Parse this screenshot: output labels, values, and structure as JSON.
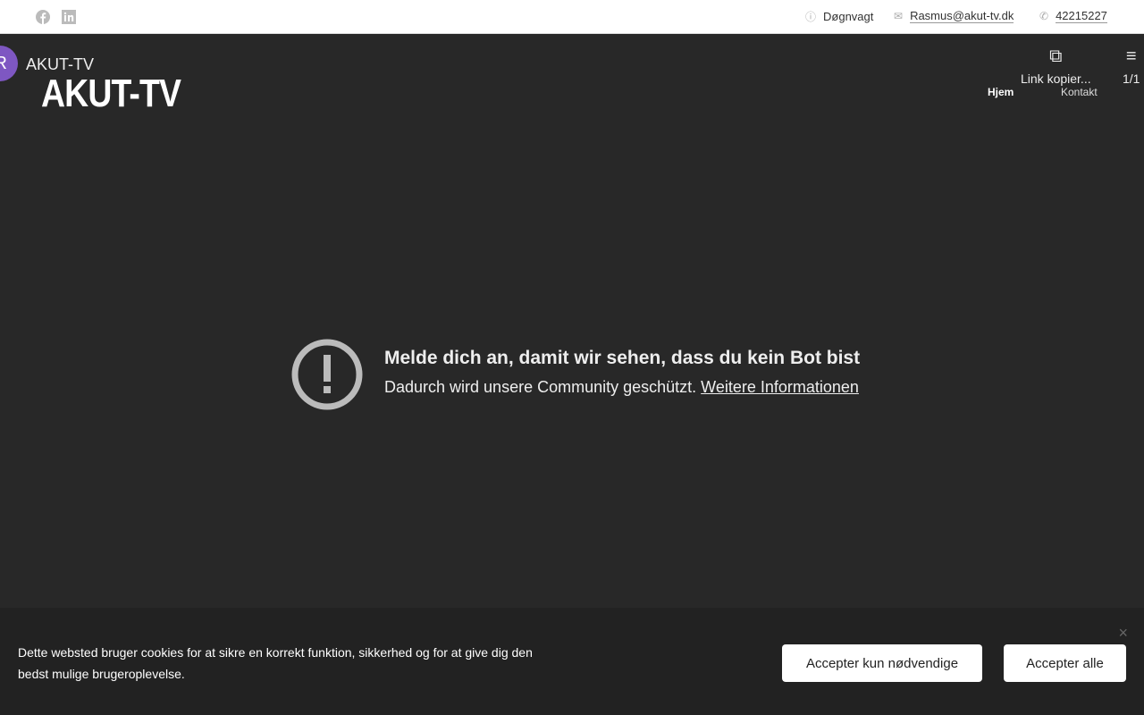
{
  "topbar": {
    "info": "Døgnvagt",
    "email": "Rasmus@akut-tv.dk",
    "phone": "42215227"
  },
  "header": {
    "avatar_letter": "R",
    "channel_title": "AKUT-TV",
    "logo": "AKUT-TV",
    "nav": [
      "Hjem",
      "Kontakt"
    ],
    "copy_label": "Link kopier...",
    "playlist_count": "1/1"
  },
  "error": {
    "title": "Melde dich an, damit wir sehen, dass du kein Bot bist",
    "text": "Dadurch wird unsere Community geschützt.",
    "link": "Weitere Informationen"
  },
  "cookie": {
    "text": "Dette websted bruger cookies for at sikre en korrekt funktion, sikkerhed og for at give dig den bedst mulige brugeroplevelse.",
    "necessary": "Accepter kun nødvendige",
    "all": "Accepter alle",
    "close": "×"
  }
}
